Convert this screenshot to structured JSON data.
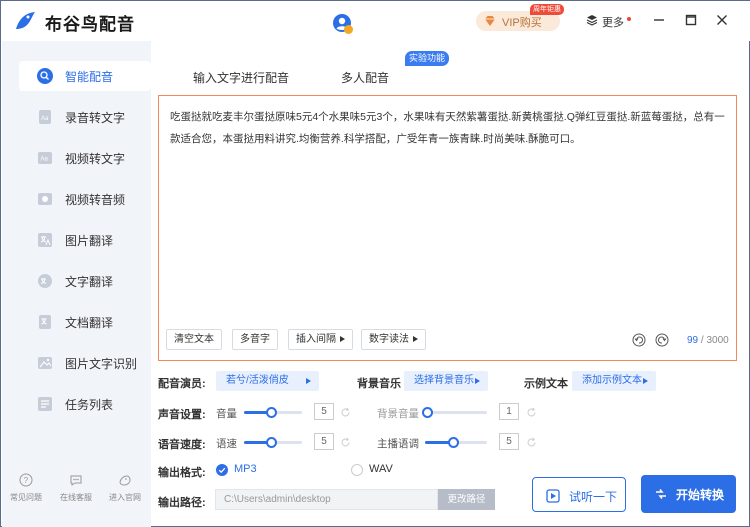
{
  "app": {
    "title": "布谷鸟配音"
  },
  "header": {
    "vip_label": "VIP购买",
    "vip_badge": "周年钜惠",
    "more_label": "更多"
  },
  "sidebar": {
    "items": [
      {
        "label": "智能配音",
        "icon": "mic-icon"
      },
      {
        "label": "录音转文字",
        "icon": "audio-file-icon"
      },
      {
        "label": "视频转文字",
        "icon": "video-text-icon"
      },
      {
        "label": "视频转音频",
        "icon": "video-audio-icon"
      },
      {
        "label": "图片翻译",
        "icon": "image-translate-icon"
      },
      {
        "label": "文字翻译",
        "icon": "text-translate-icon"
      },
      {
        "label": "文档翻译",
        "icon": "doc-translate-icon"
      },
      {
        "label": "图片文字识别",
        "icon": "ocr-icon"
      },
      {
        "label": "任务列表",
        "icon": "task-list-icon"
      }
    ],
    "footer": [
      {
        "label": "常见问题",
        "icon": "help-icon"
      },
      {
        "label": "在线客服",
        "icon": "chat-icon"
      },
      {
        "label": "进入官网",
        "icon": "bird-icon"
      }
    ]
  },
  "tabs": [
    {
      "label": "输入文字进行配音"
    },
    {
      "label": "多人配音"
    }
  ],
  "lab_badge": "实验功能",
  "editor": {
    "text": "吃蛋挞就吃麦丰尔蛋挞原味5元4个水果味5元3个，水果味有天然紫薯蛋挞.新黄桃蛋挞.Q弹红豆蛋挞.新蓝莓蛋挞，总有一款适合您，本蛋挞用料讲究.均衡营养.科学搭配，广受年青一族青睐.时尚美味.酥脆可口。",
    "toolbar": {
      "clear": "清空文本",
      "polyphone": "多音字",
      "pause": "插入间隔",
      "number": "数字读法"
    },
    "count": "99",
    "max": "/ 3000"
  },
  "settings": {
    "voice_label": "配音演员:",
    "voice_value": "若兮/活泼俏皮",
    "bgm_label": "背景音乐",
    "bgm_value": "选择背景音乐",
    "sample_label": "示例文本",
    "sample_value": "添加示例文本",
    "sound_label": "声音设置:",
    "volume_label": "音量",
    "volume_value": "5",
    "bg_volume_label": "背景音量",
    "bg_volume_value": "1",
    "speed_label": "语音速度:",
    "rate_label": "语速",
    "rate_value": "5",
    "pitch_label": "主播语调",
    "pitch_value": "5",
    "format_label": "输出格式:",
    "format_mp3": "MP3",
    "format_wav": "WAV",
    "path_label": "输出路径:",
    "path_value": "C:\\Users\\admin\\desktop",
    "path_button": "更改路径"
  },
  "actions": {
    "listen": "试听一下",
    "start": "开始转换"
  },
  "colors": {
    "accent": "#2b6ee6",
    "editor_border": "#f08a5d",
    "sidebar_bg": "#f1f4f9"
  }
}
